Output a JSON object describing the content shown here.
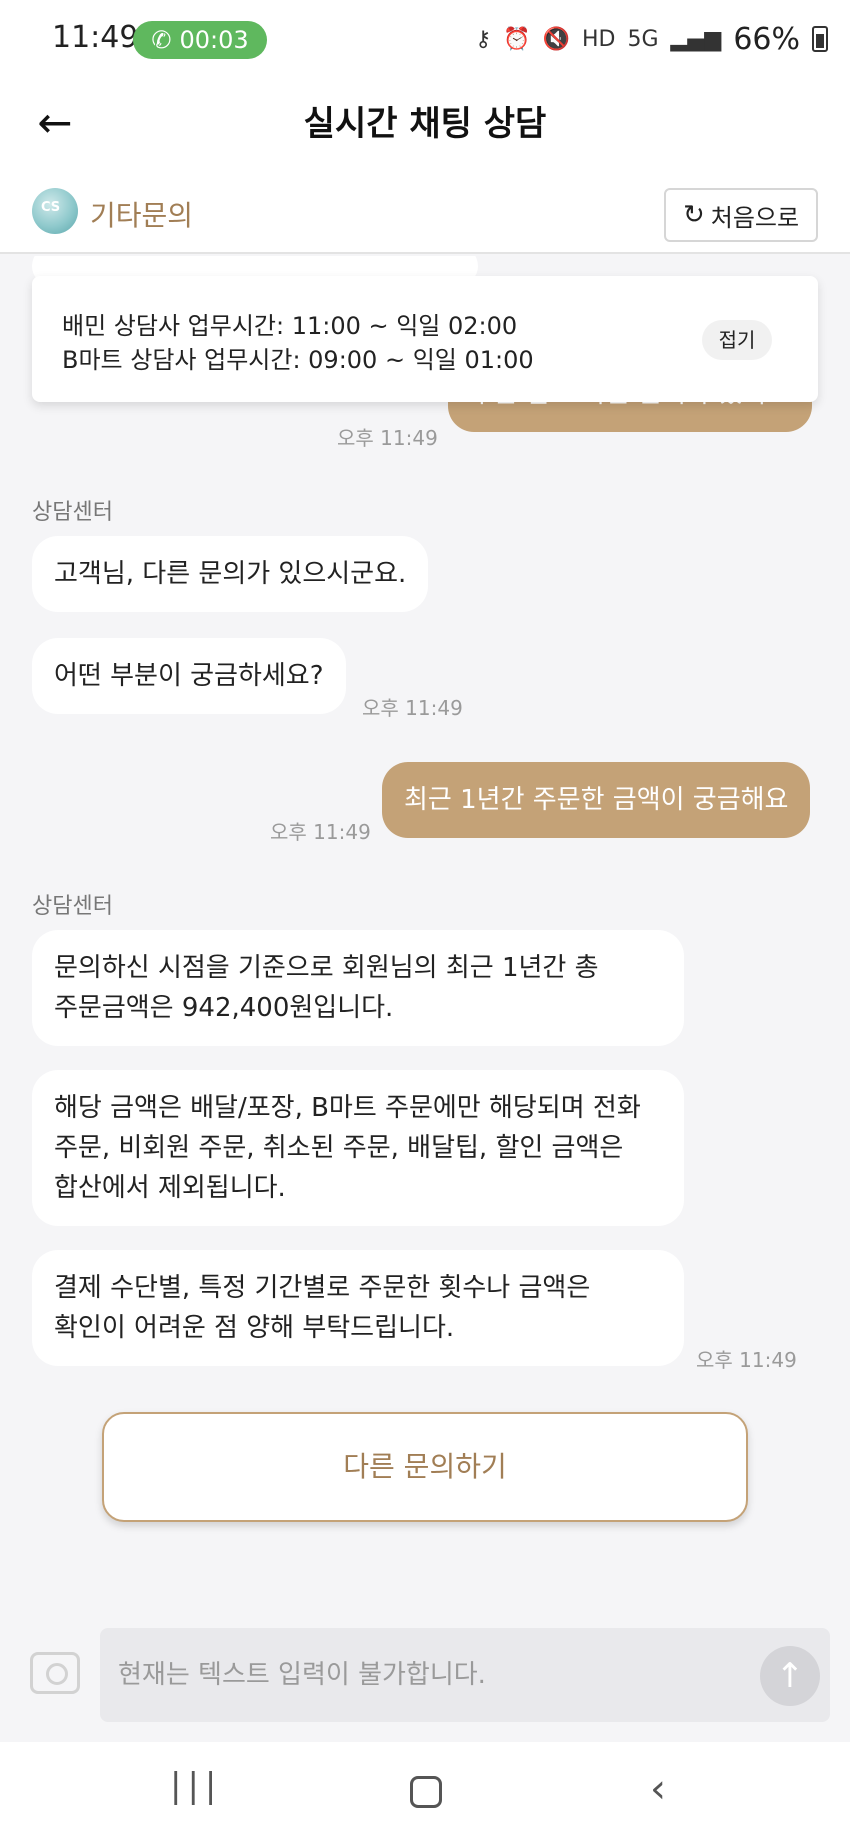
{
  "status_bar": {
    "time": "11:49",
    "call_timer": "00:03",
    "battery": "66%",
    "icons": [
      "key-icon",
      "alarm-icon",
      "mute-icon",
      "hd-icon",
      "5g-icon",
      "signal-icon",
      "battery-icon"
    ]
  },
  "header": {
    "title": "실시간 채팅 상담"
  },
  "subheader": {
    "category": "기타문의",
    "restart_label": "처음으로"
  },
  "hours_notice": {
    "line1": "배민 상담사 업무시간: 11:00 ~ 익일 02:00",
    "line2": "B마트 상담사 업무시간: 09:00 ~ 익일 01:00",
    "fold_label": "접기"
  },
  "messages": {
    "user1": {
      "text": "주문 말고 다른 문의가 있어요",
      "time": "오후 11:49"
    },
    "sender1": "상담센터",
    "bot1": {
      "text": "고객님, 다른 문의가 있으시군요."
    },
    "bot2": {
      "text": "어떤 부분이 궁금하세요?",
      "time": "오후 11:49"
    },
    "user2": {
      "text": "최근 1년간 주문한 금액이 궁금해요",
      "time": "오후 11:49"
    },
    "sender2": "상담센터",
    "bot3": {
      "line1": "문의하신 시점을 기준으로 회원님의 최근 1년간 총",
      "line2": "주문금액은 942,400원입니다."
    },
    "bot4": {
      "line1": "해당 금액은 배달/포장, B마트 주문에만 해당되며 전화",
      "line2": "주문, 비회원 주문, 취소된 주문, 배달팁, 할인 금액은",
      "line3": "합산에서 제외됩니다."
    },
    "bot5": {
      "line1": "결제 수단별, 특정 기간별로 주문한 횟수나 금액은",
      "line2": "확인이 어려운 점 양해 부탁드립니다.",
      "time": "오후 11:49"
    }
  },
  "actions": {
    "other_inquiry": "다른 문의하기"
  },
  "input": {
    "placeholder": "현재는 텍스트 입력이 불가합니다."
  },
  "colors": {
    "accent": "#c4a277",
    "accent_text": "#a17e55",
    "call_green": "#5fb85e"
  }
}
